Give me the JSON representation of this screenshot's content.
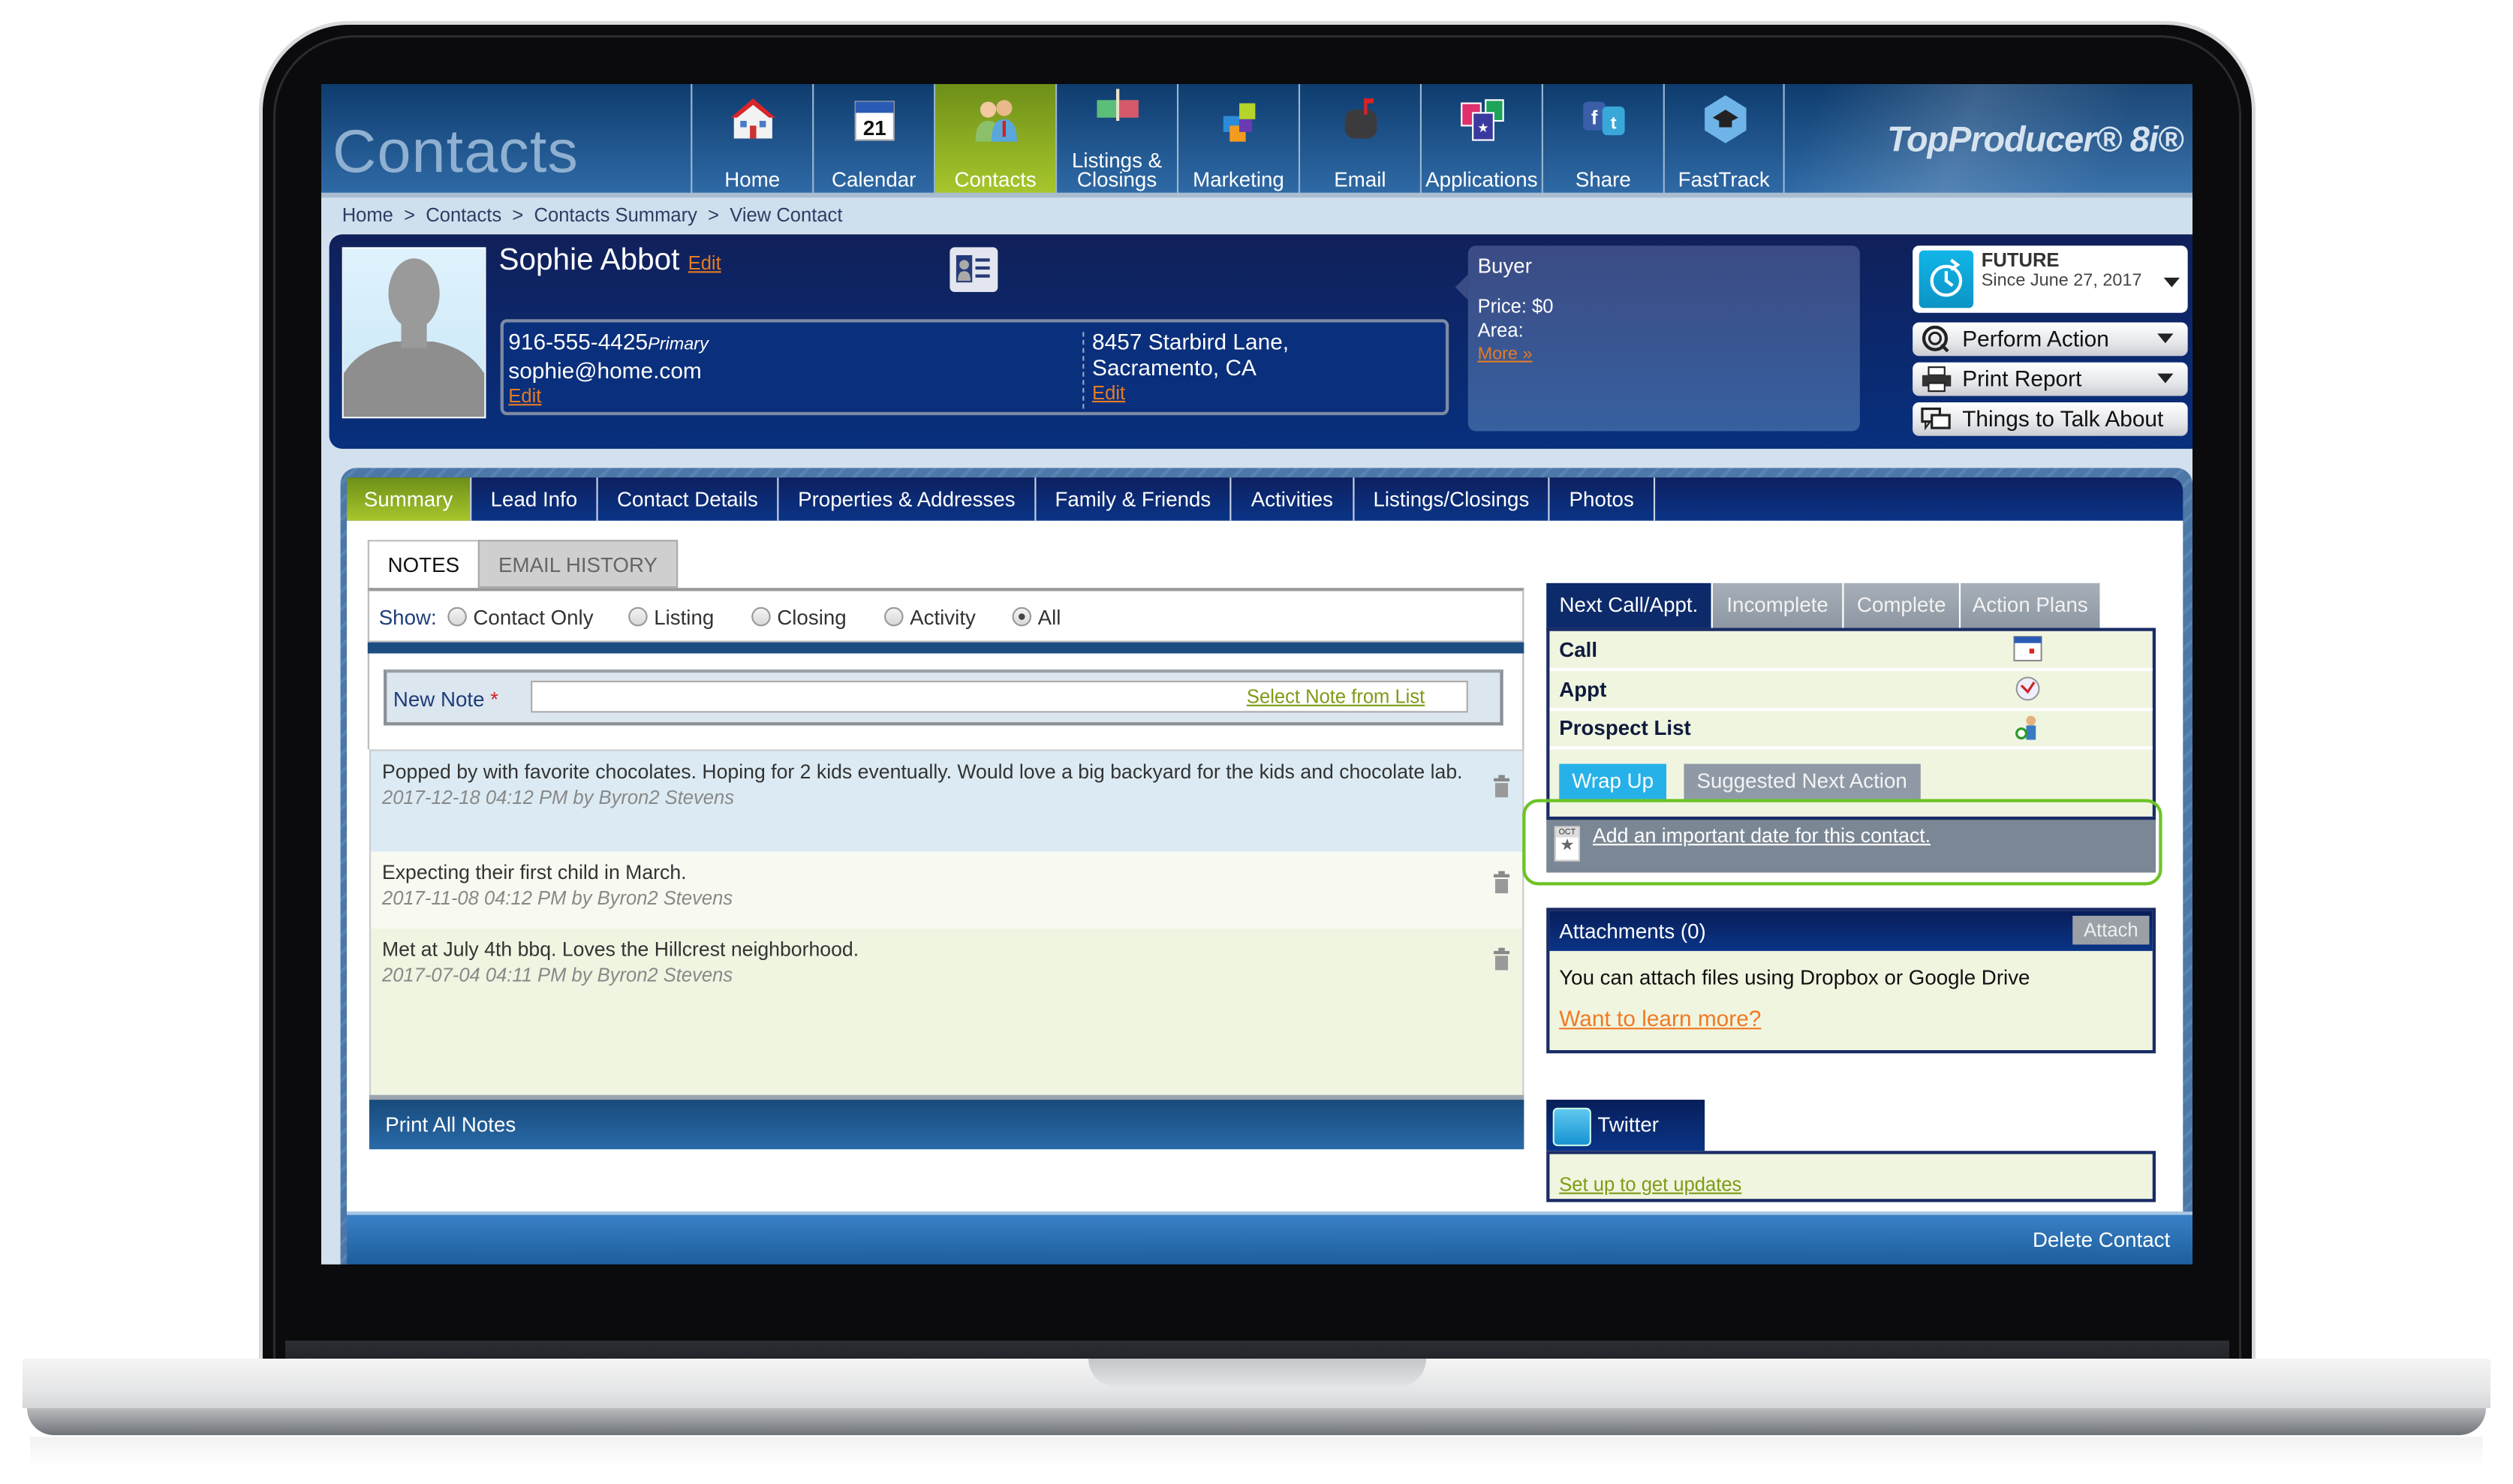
{
  "header": {
    "section_title": "Contacts",
    "brand": "TopProducer® 8i®",
    "nav": [
      {
        "label": "Home",
        "icon": "house-icon",
        "active": false
      },
      {
        "label": "Calendar",
        "icon": "calendar-icon",
        "active": false
      },
      {
        "label": "Contacts",
        "icon": "people-icon",
        "active": true
      },
      {
        "label": "Listings & Closings",
        "icon": "sold-sign-icon",
        "active": false
      },
      {
        "label": "Marketing",
        "icon": "puzzle-icon",
        "active": false
      },
      {
        "label": "Email",
        "icon": "mailbox-icon",
        "active": false
      },
      {
        "label": "Applications",
        "icon": "apps-icon",
        "active": false
      },
      {
        "label": "Share",
        "icon": "social-share-icon",
        "active": false
      },
      {
        "label": "FastTrack",
        "icon": "graduation-cap-icon",
        "active": false
      }
    ]
  },
  "breadcrumb": "Home  >  Contacts  >  Contacts Summary  >  View Contact",
  "contact": {
    "name": "Sophie Abbot",
    "edit_label": "Edit",
    "phone": "916-555-4425",
    "phone_type": "Primary",
    "email": "sophie@home.com",
    "address_line1": "8457 Starbird Lane,",
    "address_line2": "Sacramento, CA",
    "buyer": {
      "type": "Buyer",
      "price": "Price: $0",
      "area": "Area:",
      "more_link": "More »"
    },
    "status": {
      "label": "FUTURE",
      "since": "Since June 27, 2017"
    },
    "actions": [
      {
        "label": "Perform Action",
        "icon": "target-search-icon",
        "dropdown": true
      },
      {
        "label": "Print Report",
        "icon": "printer-icon",
        "dropdown": true
      },
      {
        "label": "Things to Talk About",
        "icon": "chat-bubbles-icon",
        "dropdown": false
      }
    ]
  },
  "tabs": [
    {
      "label": "Summary",
      "active": true
    },
    {
      "label": "Lead Info",
      "active": false
    },
    {
      "label": "Contact Details",
      "active": false
    },
    {
      "label": "Properties & Addresses",
      "active": false
    },
    {
      "label": "Family & Friends",
      "active": false
    },
    {
      "label": "Activities",
      "active": false
    },
    {
      "label": "Listings/Closings",
      "active": false
    },
    {
      "label": "Photos",
      "active": false
    }
  ],
  "notes_panel": {
    "tabs": [
      {
        "label": "NOTES",
        "active": true
      },
      {
        "label": "EMAIL HISTORY",
        "active": false
      }
    ],
    "show_label": "Show:",
    "filters": [
      {
        "label": "Contact Only",
        "selected": false
      },
      {
        "label": "Listing",
        "selected": false
      },
      {
        "label": "Closing",
        "selected": false
      },
      {
        "label": "Activity",
        "selected": false
      },
      {
        "label": "All",
        "selected": true
      }
    ],
    "new_note_label": "New Note",
    "required_marker": "*",
    "new_note_value": "",
    "select_note_link": "Select Note from List",
    "notes": [
      {
        "text": "Popped by with favorite chocolates. Hoping for 2 kids eventually. Would love a big backyard for the kids and chocolate lab.",
        "meta": "2017-12-18 04:12 PM by Byron2 Stevens"
      },
      {
        "text": "Expecting their first child in March.",
        "meta": "2017-11-08 04:12 PM by Byron2 Stevens"
      },
      {
        "text": "Met at July 4th bbq. Loves the Hillcrest neighborhood.",
        "meta": "2017-07-04 04:11 PM by Byron2 Stevens"
      }
    ],
    "print_all": "Print All Notes"
  },
  "next_panel": {
    "tabs": [
      {
        "label": "Next Call/Appt.",
        "active": true
      },
      {
        "label": "Incomplete",
        "active": false
      },
      {
        "label": "Complete",
        "active": false
      },
      {
        "label": "Action Plans",
        "active": false
      }
    ],
    "rows": [
      {
        "label": "Call",
        "icon": "calendar-icon"
      },
      {
        "label": "Appt",
        "icon": "clock-icon"
      },
      {
        "label": "Prospect List",
        "icon": "add-person-icon"
      }
    ],
    "wrap_up": "Wrap Up",
    "suggested": "Suggested Next Action",
    "important_date_link": "Add an important date for this contact.",
    "date_icon_month": "OCT"
  },
  "attachments": {
    "title": "Attachments (0)",
    "attach_button": "Attach",
    "text": "You can attach files using Dropbox or Google Drive",
    "learn_more": "Want to learn more?"
  },
  "twitter": {
    "title": "Twitter",
    "setup_link": "Set up to get updates"
  },
  "footer": {
    "delete_contact": "Delete Contact"
  },
  "colors": {
    "accent_green": "#a7c62c",
    "navy": "#0a3487",
    "link_orange": "#e47c24",
    "highlight_green": "#6cc326",
    "wrap_up_blue": "#26b1e8"
  }
}
